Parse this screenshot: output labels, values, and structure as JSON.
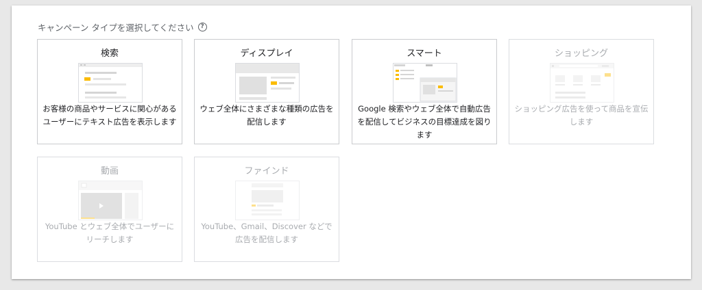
{
  "header": {
    "title": "キャンペーン タイプを選択してください",
    "help_icon": "?"
  },
  "cards": [
    {
      "id": "search",
      "title": "検索",
      "description": "お客様の商品やサービスに関心があるユーザーにテキスト広告を表示します",
      "enabled": true,
      "icon": "search-ad-illustration"
    },
    {
      "id": "display",
      "title": "ディスプレイ",
      "description": "ウェブ全体にさまざまな種類の広告を配信します",
      "enabled": true,
      "icon": "display-ad-illustration"
    },
    {
      "id": "smart",
      "title": "スマート",
      "description": "Google 検索やウェブ全体で自動広告を配信してビジネスの目標達成を図ります",
      "enabled": true,
      "icon": "smart-ad-illustration"
    },
    {
      "id": "shopping",
      "title": "ショッピング",
      "description": "ショッピング広告を使って商品を宣伝します",
      "enabled": false,
      "icon": "shopping-ad-illustration"
    },
    {
      "id": "video",
      "title": "動画",
      "description": "YouTube とウェブ全体でユーザーにリーチします",
      "enabled": false,
      "icon": "video-ad-illustration"
    },
    {
      "id": "discovery",
      "title": "ファインド",
      "description": "YouTube、Gmail、Discover などで広告を配信します",
      "enabled": false,
      "icon": "discovery-ad-illustration"
    }
  ],
  "colors": {
    "accent_yellow": "#fbbc04",
    "text": "#202124",
    "text_muted": "#5f6368",
    "text_disabled": "#a8abaf",
    "border": "#dadce0"
  }
}
